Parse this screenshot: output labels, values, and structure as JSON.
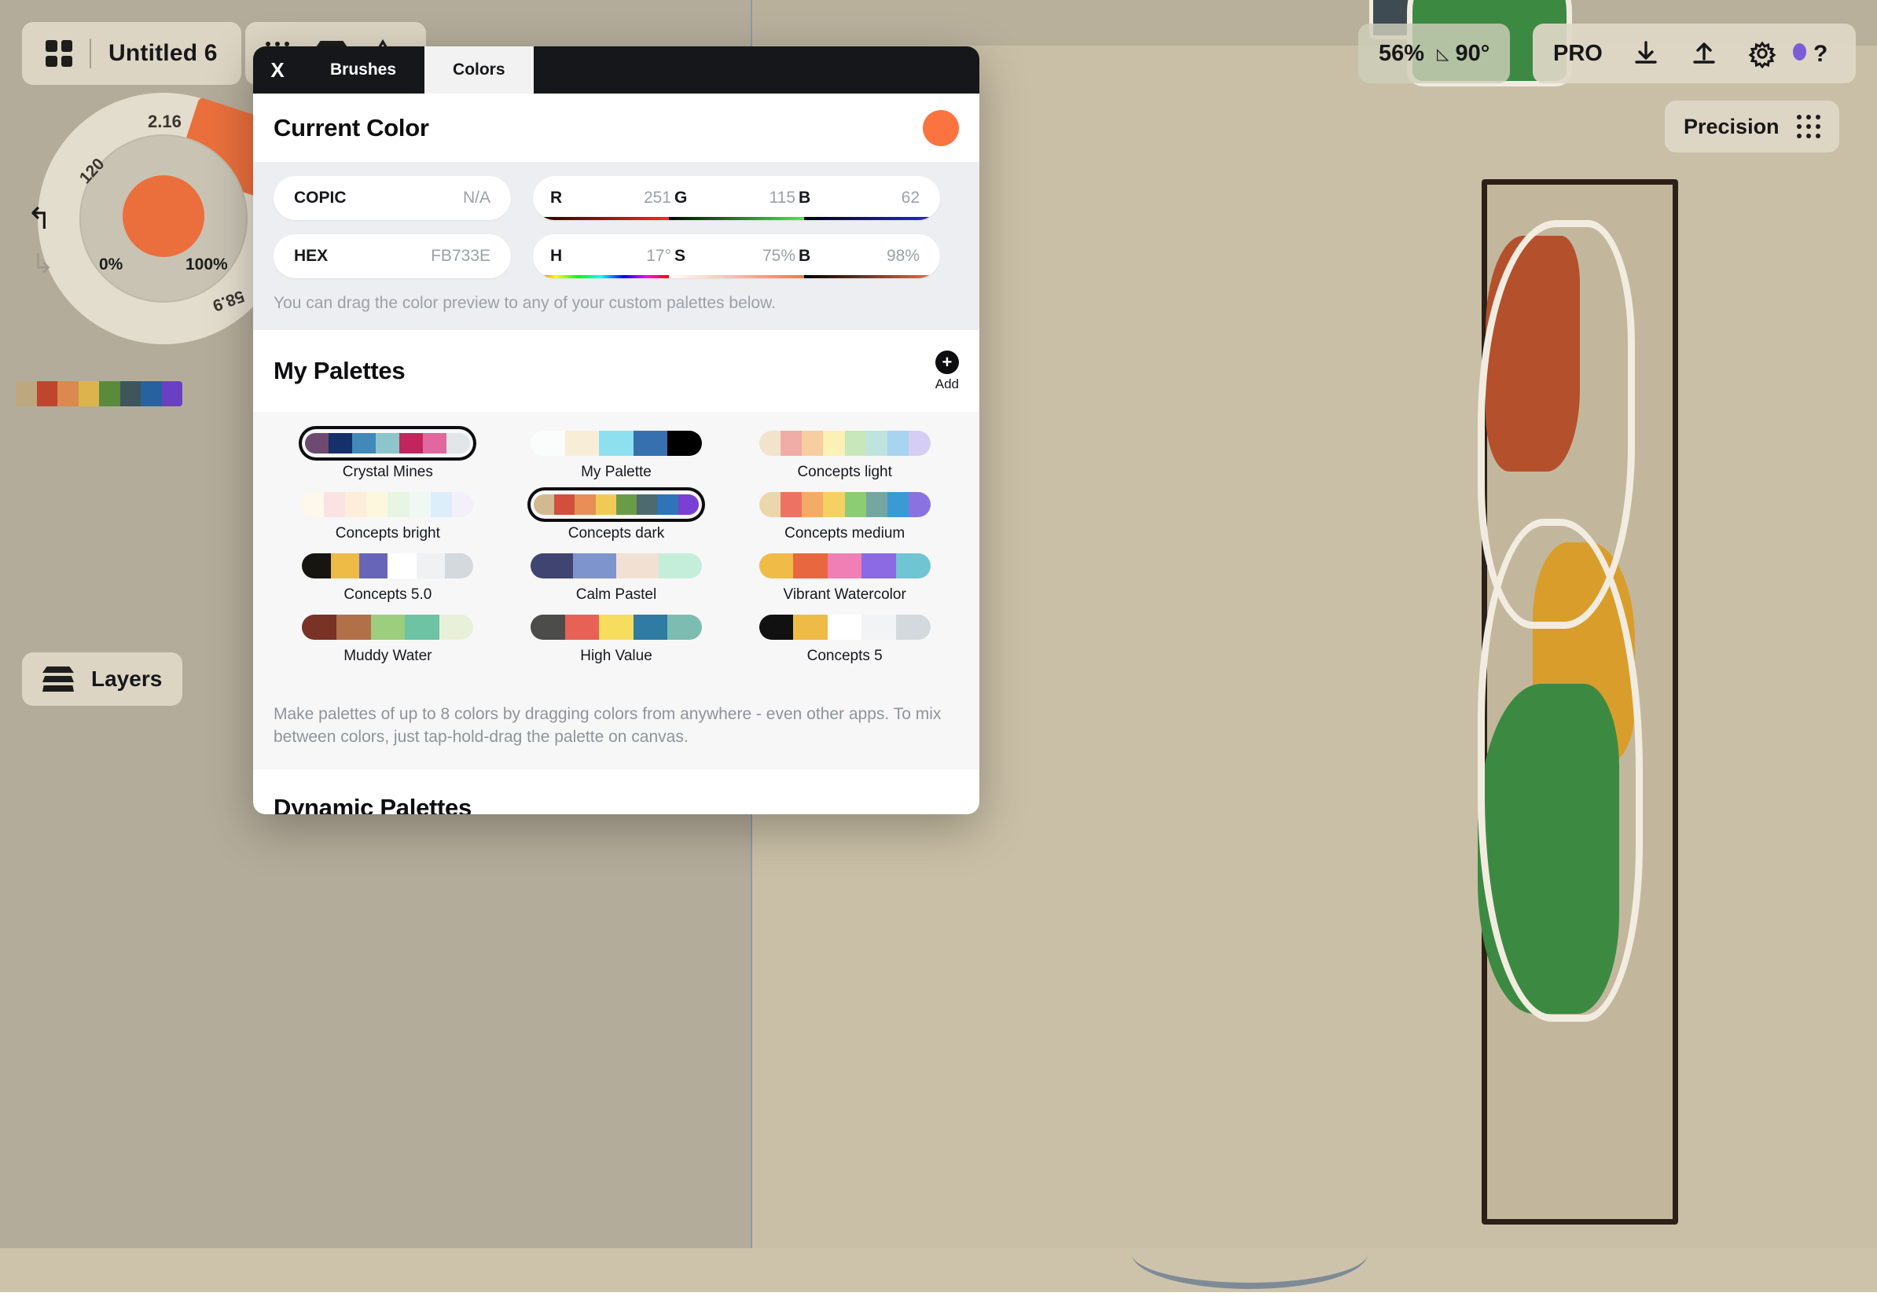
{
  "app": {
    "document_title": "Untitled 6",
    "zoom_level": "56%",
    "rotation": "90°",
    "pro_label": "PRO",
    "precision_label": "Precision",
    "layers_label": "Layers"
  },
  "wheel": {
    "size_value": "2.16",
    "left_value": "120",
    "right_value": "58.9",
    "min_label": "0%",
    "max_label": "100%",
    "current_color": "#EA6F3C"
  },
  "left_strip": {
    "colors": [
      "#bda77f",
      "#c0452f",
      "#da8a4e",
      "#dcb44d",
      "#5b8a3c",
      "#3e565b",
      "#27629e",
      "#6b3fc4"
    ]
  },
  "modal": {
    "close_label": "X",
    "tabs": [
      {
        "label": "Brushes",
        "active": false
      },
      {
        "label": "Colors",
        "active": true
      }
    ],
    "current_color": {
      "heading": "Current Color",
      "swatch_hex": "#FB733E",
      "copic_label": "COPIC",
      "copic_value": "N/A",
      "hex_label": "HEX",
      "hex_value": "FB733E",
      "rgb": [
        {
          "label": "R",
          "value": "251"
        },
        {
          "label": "G",
          "value": "115"
        },
        {
          "label": "B",
          "value": "62"
        }
      ],
      "hsb": [
        {
          "label": "H",
          "value": "17°"
        },
        {
          "label": "S",
          "value": "75%"
        },
        {
          "label": "B",
          "value": "98%"
        }
      ],
      "hint": "You can drag the color preview to any of your custom palettes below."
    },
    "my_palettes": {
      "heading": "My Palettes",
      "add_label": "Add",
      "add_icon": "plus-icon",
      "footer": "Make palettes of up to 8 colors by dragging colors from anywhere - even other apps. To mix between colors, just tap-hold-drag the palette on canvas.",
      "items": [
        {
          "name": "Crystal Mines",
          "selected": true,
          "colors": [
            "#6f4a70",
            "#16306b",
            "#4189b9",
            "#8cc6ca",
            "#c0265b",
            "#e0689f",
            "#e2e6e9"
          ]
        },
        {
          "name": "My Palette",
          "selected": false,
          "colors": [
            "#fbfdfd",
            "#f8eed8",
            "#8ee0ef",
            "#3670ae",
            "#000000"
          ]
        },
        {
          "name": "Concepts light",
          "selected": false,
          "colors": [
            "#f2e3cd",
            "#f0aca6",
            "#f6ceA0",
            "#fbf0b6",
            "#c8e7bb",
            "#bfe3de",
            "#a8d4ef",
            "#d6cdf5"
          ]
        },
        {
          "name": "Concepts bright",
          "selected": false,
          "colors": [
            "#fdf8ea",
            "#fbe3e3",
            "#fdeedb",
            "#fdf8dd",
            "#e6f6e2",
            "#f0f8f4",
            "#dceefa",
            "#f3effb"
          ]
        },
        {
          "name": "Concepts dark",
          "selected": true,
          "colors": [
            "#d3b98f",
            "#d14f3d",
            "#e78f54",
            "#f0ca54",
            "#6a9b46",
            "#4d6b6f",
            "#2e74b6",
            "#7a3fd4"
          ]
        },
        {
          "name": "Concepts medium",
          "selected": false,
          "colors": [
            "#ecd6ab",
            "#ee7264",
            "#f3ac68",
            "#f6d063",
            "#8ccd74",
            "#76a6a2",
            "#3b9ad4",
            "#8a73e0"
          ]
        },
        {
          "name": "Concepts 5.0",
          "selected": false,
          "colors": [
            "#17150f",
            "#eebb47",
            "#6665b8",
            "#ffffff",
            "#eff1f2",
            "#d3d9dc"
          ]
        },
        {
          "name": "Calm Pastel",
          "selected": false,
          "colors": [
            "#3f4570",
            "#7e94cd",
            "#f2e1d3",
            "#c5eeda"
          ]
        },
        {
          "name": "Vibrant Watercolor",
          "selected": false,
          "colors": [
            "#f0bb47",
            "#e8673f",
            "#f07fb5",
            "#8b6ae3",
            "#70c5d2"
          ]
        },
        {
          "name": "Muddy Water",
          "selected": false,
          "colors": [
            "#7a3226",
            "#b27049",
            "#9cce7e",
            "#6dc3a3",
            "#e9f0da"
          ]
        },
        {
          "name": "High Value",
          "selected": false,
          "colors": [
            "#4c4c4a",
            "#e76254",
            "#f7dd5e",
            "#2f7ba3",
            "#7dbcb1"
          ]
        },
        {
          "name": "Concepts 5",
          "selected": false,
          "colors": [
            "#111111",
            "#eebb47",
            "#ffffff",
            "#f2f3f4",
            "#d3d9dc"
          ]
        }
      ]
    },
    "dynamic_palettes": {
      "heading": "Dynamic Palettes"
    }
  }
}
